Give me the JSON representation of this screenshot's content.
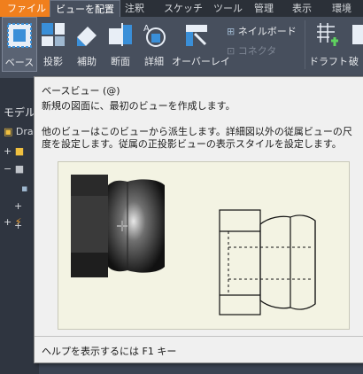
{
  "tabs": [
    {
      "label": "ファイル"
    },
    {
      "label": "ビューを配置"
    },
    {
      "label": "注釈"
    },
    {
      "label": "スケッチ"
    },
    {
      "label": "ツール"
    },
    {
      "label": "管理"
    },
    {
      "label": "表示"
    },
    {
      "label": "環境"
    }
  ],
  "ribbon": {
    "base": "ベース",
    "projected": "投影",
    "auxiliary": "補助",
    "section": "断面",
    "detail": "詳細",
    "overlay": "オーバーレイ",
    "nailboard": "ネイルボード",
    "connector": "コネクタ",
    "draft": "ドラフト",
    "broken": "破"
  },
  "browser": {
    "title": "モデル",
    "item_dra": "Dra"
  },
  "tooltip": {
    "title": "ベースビュー (@)",
    "description": "新規の図面に、最初のビューを作成します。",
    "detail": "他のビューはこのビューから派生します。詳細図以外の従属ビューの尺度を設定します。従属の正投影ビューの表示スタイルを設定します。",
    "footer": "ヘルプを表示するには F1 キー"
  },
  "colors": {
    "file_tab": "#f07f1d",
    "ribbon": "#474f5d",
    "tooltip_bg": "#f0f0f0"
  }
}
